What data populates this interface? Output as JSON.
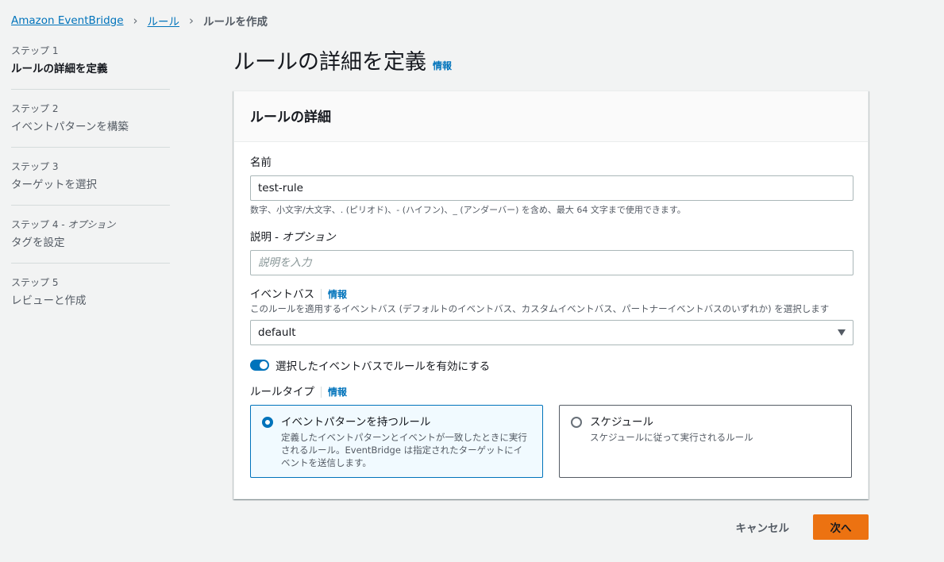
{
  "breadcrumb": {
    "items": [
      "Amazon EventBridge",
      "ルール"
    ],
    "current": "ルールを作成"
  },
  "steps": [
    {
      "num": "ステップ 1",
      "optional": "",
      "label": "ルールの詳細を定義",
      "active": true
    },
    {
      "num": "ステップ 2",
      "optional": "",
      "label": "イベントパターンを構築",
      "active": false
    },
    {
      "num": "ステップ 3",
      "optional": "",
      "label": "ターゲットを選択",
      "active": false
    },
    {
      "num": "ステップ 4",
      "optional": " - オプション",
      "label": "タグを設定",
      "active": false
    },
    {
      "num": "ステップ 5",
      "optional": "",
      "label": "レビューと作成",
      "active": false
    }
  ],
  "page": {
    "title": "ルールの詳細を定義",
    "info": "情報"
  },
  "panel": {
    "title": "ルールの詳細",
    "name": {
      "label": "名前",
      "value": "test-rule",
      "hint": "数字、小文字/大文字、. (ピリオド)、- (ハイフン)、_ (アンダーバー) を含め、最大 64 文字まで使用できます。"
    },
    "description": {
      "label": "説明",
      "optional": "- オプション",
      "placeholder": "説明を入力"
    },
    "event_bus": {
      "label": "イベントバス",
      "info": "情報",
      "hint": "このルールを適用するイベントバス (デフォルトのイベントバス、カスタムイベントバス、パートナーイベントバスのいずれか) を選択します",
      "value": "default"
    },
    "toggle": {
      "label": "選択したイベントバスでルールを有効にする",
      "enabled": true
    },
    "rule_type": {
      "label": "ルールタイプ",
      "info": "情報",
      "options": [
        {
          "title": "イベントパターンを持つルール",
          "desc": "定義したイベントパターンとイベントが一致したときに実行されるルール。EventBridge は指定されたターゲットにイベントを送信します。",
          "selected": true
        },
        {
          "title": "スケジュール",
          "desc": "スケジュールに従って実行されるルール",
          "selected": false
        }
      ]
    }
  },
  "footer": {
    "cancel": "キャンセル",
    "next": "次へ"
  },
  "colors": {
    "accent": "#0073bb",
    "primary_button": "#ec7211",
    "background": "#f2f3f3"
  }
}
